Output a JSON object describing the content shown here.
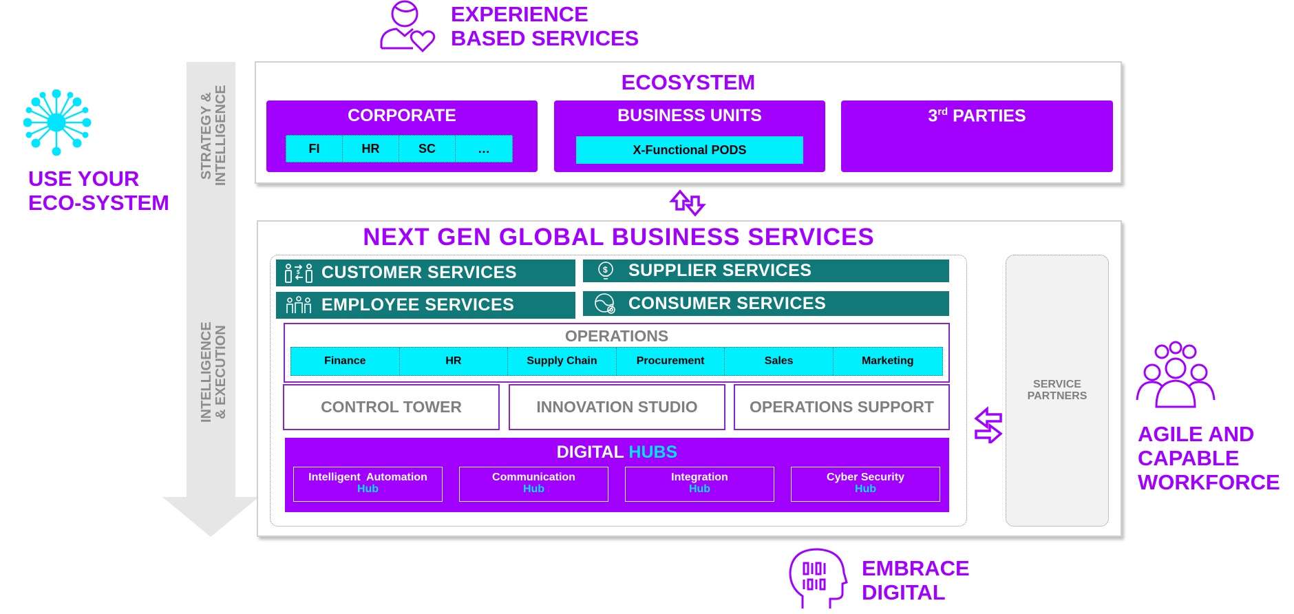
{
  "corner_labels": {
    "experience": [
      "EXPERIENCE",
      "BASED SERVICES"
    ],
    "ecosystem_use": [
      "USE YOUR",
      "ECO-SYSTEM"
    ],
    "workforce": [
      "AGILE AND",
      "CAPABLE",
      "WORKFORCE"
    ],
    "digital": [
      "EMBRACE",
      "DIGITAL"
    ]
  },
  "side_arrow": {
    "top_text": [
      "STRATEGY &",
      "INTELLIGENCE"
    ],
    "bottom_text": [
      "INTELLIGENCE",
      "& EXECUTION"
    ]
  },
  "ecosystem": {
    "title": "ECOSYSTEM",
    "corporate": {
      "title": "CORPORATE",
      "cells": [
        "FI",
        "HR",
        "SC",
        "…"
      ]
    },
    "business_units": {
      "title": "BUSINESS UNITS",
      "pods": "X-Functional PODS"
    },
    "third_parties": {
      "prefix": "3",
      "sup": "rd",
      "suffix": " PARTIES"
    }
  },
  "gbs": {
    "title": "NEXT GEN GLOBAL BUSINESS SERVICES",
    "services": {
      "customer": "CUSTOMER SERVICES",
      "supplier": "SUPPLIER SERVICES",
      "employee": "EMPLOYEE SERVICES",
      "consumer": "CONSUMER SERVICES"
    },
    "operations": {
      "title": "OPERATIONS",
      "cells": [
        "Finance",
        "HR",
        "Supply Chain",
        "Procurement",
        "Sales",
        "Marketing"
      ]
    },
    "pillars": [
      "CONTROL TOWER",
      "INNOVATION STUDIO",
      "OPERATIONS SUPPORT"
    ],
    "digital_hubs": {
      "title_a": "DIGITAL",
      "title_b": "HUBS",
      "hubs": [
        {
          "name": "Intelligent  Automation",
          "suffix": "Hub"
        },
        {
          "name": "Communication",
          "suffix": "Hub"
        },
        {
          "name": "Integration",
          "suffix": "Hub"
        },
        {
          "name": "Cyber Security",
          "suffix": "Hub"
        }
      ]
    },
    "service_partners": [
      "SERVICE",
      "PARTNERS"
    ]
  },
  "colors": {
    "purple": "#a100ff",
    "teal": "#117a78",
    "cyan": "#00f0ff",
    "grey": "#7f7f7f"
  },
  "icons": [
    "person-heart-icon",
    "network-hub-icon",
    "workforce-group-icon",
    "digital-head-icon",
    "bidirectional-vertical-arrow-icon",
    "bidirectional-horizontal-arrow-icon",
    "customer-exchange-icon",
    "supplier-money-bulb-icon",
    "employee-group-icon",
    "consumer-globe-gear-icon"
  ]
}
